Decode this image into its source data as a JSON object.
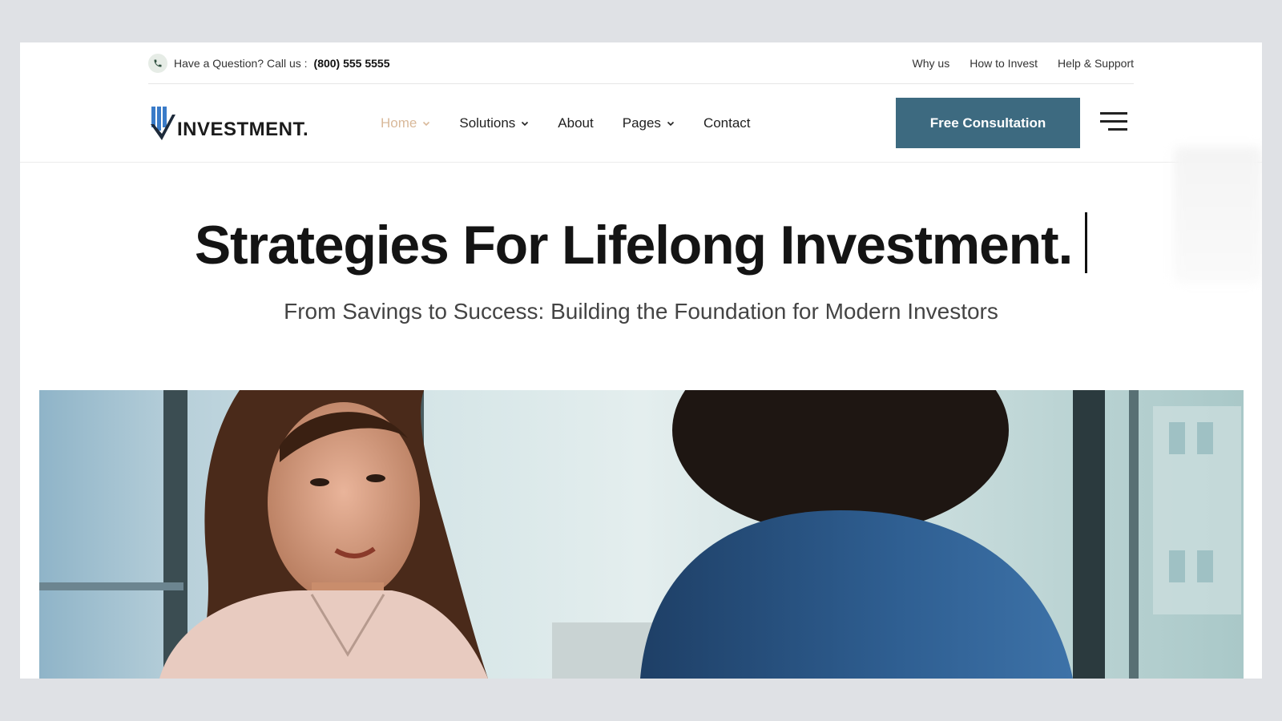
{
  "topbar": {
    "question_label": "Have a Question? Call us :",
    "phone_number": "(800) 555 5555",
    "links": [
      "Why us",
      "How to Invest",
      "Help & Support"
    ]
  },
  "header": {
    "logo_text": "INVESTMENT.",
    "nav": [
      {
        "label": "Home",
        "has_dropdown": true,
        "active": true
      },
      {
        "label": "Solutions",
        "has_dropdown": true,
        "active": false
      },
      {
        "label": "About",
        "has_dropdown": false,
        "active": false
      },
      {
        "label": "Pages",
        "has_dropdown": true,
        "active": false
      },
      {
        "label": "Contact",
        "has_dropdown": false,
        "active": false
      }
    ],
    "cta_label": "Free Consultation",
    "menu_icon": "hamburger-icon"
  },
  "hero": {
    "title": "Strategies For Lifelong Investment.",
    "subtitle": "From Savings to Success: Building the Foundation for Modern Investors"
  },
  "colors": {
    "accent": "#3d6a80",
    "nav_active": "#d9b99a",
    "logo_blue": "#3a7bc8"
  }
}
